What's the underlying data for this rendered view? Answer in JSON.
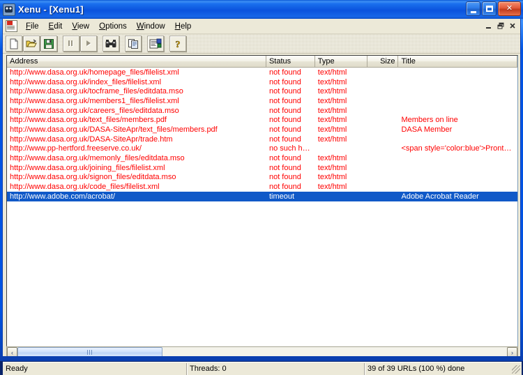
{
  "window": {
    "title": "Xenu - [Xenu1]",
    "app_icon": "xenu-cat-icon",
    "controls": {
      "minimize": "Minimize",
      "maximize": "Maximize",
      "close": "Close"
    }
  },
  "menubar": {
    "doc_icon": "document-icon",
    "items": [
      {
        "label": "File",
        "accel": "F"
      },
      {
        "label": "Edit",
        "accel": "E"
      },
      {
        "label": "View",
        "accel": "V"
      },
      {
        "label": "Options",
        "accel": "O"
      },
      {
        "label": "Window",
        "accel": "W"
      },
      {
        "label": "Help",
        "accel": "H"
      }
    ],
    "mdi_controls": {
      "minimize": "Minimize Document",
      "restore": "Restore Document",
      "close": "Close Document"
    }
  },
  "toolbar": {
    "buttons": [
      {
        "name": "new-file-button",
        "label": "New",
        "enabled": true
      },
      {
        "name": "open-file-button",
        "label": "Open",
        "enabled": true
      },
      {
        "name": "save-file-button",
        "label": "Save",
        "enabled": true
      },
      {
        "name": "pause-button",
        "label": "Pause",
        "enabled": false
      },
      {
        "name": "resume-button",
        "label": "Resume",
        "enabled": false
      },
      {
        "name": "find-button",
        "label": "Find",
        "enabled": true
      },
      {
        "name": "copy-button",
        "label": "Copy",
        "enabled": true
      },
      {
        "name": "properties-button",
        "label": "Properties",
        "enabled": true
      },
      {
        "name": "help-button",
        "label": "Help",
        "enabled": true
      }
    ]
  },
  "list": {
    "columns": [
      {
        "key": "address",
        "label": "Address",
        "align": "left"
      },
      {
        "key": "status",
        "label": "Status",
        "align": "left"
      },
      {
        "key": "type",
        "label": "Type",
        "align": "left"
      },
      {
        "key": "size",
        "label": "Size",
        "align": "right"
      },
      {
        "key": "title",
        "label": "Title",
        "align": "left"
      }
    ],
    "rows": [
      {
        "address": "http://www.dasa.org.uk/homepage_files/filelist.xml",
        "status": "not found",
        "type": "text/html",
        "size": "",
        "title": "",
        "state": "error"
      },
      {
        "address": "http://www.dasa.org.uk/index_files/filelist.xml",
        "status": "not found",
        "type": "text/html",
        "size": "",
        "title": "",
        "state": "error"
      },
      {
        "address": "http://www.dasa.org.uk/tocframe_files/editdata.mso",
        "status": "not found",
        "type": "text/html",
        "size": "",
        "title": "",
        "state": "error"
      },
      {
        "address": "http://www.dasa.org.uk/members1_files/filelist.xml",
        "status": "not found",
        "type": "text/html",
        "size": "",
        "title": "",
        "state": "error"
      },
      {
        "address": "http://www.dasa.org.uk/careers_files/editdata.mso",
        "status": "not found",
        "type": "text/html",
        "size": "",
        "title": "",
        "state": "error"
      },
      {
        "address": "http://www.dasa.org.uk/text_files/members.pdf",
        "status": "not found",
        "type": "text/html",
        "size": "",
        "title": "Members on line",
        "state": "error"
      },
      {
        "address": "http://www.dasa.org.uk/DASA-SiteApr/text_files/members.pdf",
        "status": "not found",
        "type": "text/html",
        "size": "",
        "title": "DASA Member",
        "state": "error"
      },
      {
        "address": "http://www.dasa.org.uk/DASA-SiteApr/trade.htm",
        "status": "not found",
        "type": "text/html",
        "size": "",
        "title": "",
        "state": "error"
      },
      {
        "address": "http://www.pp-hertford.freeserve.co.uk/",
        "status": "no such host",
        "type": "",
        "size": "",
        "title": "<span style='color:blue'>Prontap…",
        "state": "error"
      },
      {
        "address": "http://www.dasa.org.uk/memonly_files/editdata.mso",
        "status": "not found",
        "type": "text/html",
        "size": "",
        "title": "",
        "state": "error"
      },
      {
        "address": "http://www.dasa.org.uk/joining_files/filelist.xml",
        "status": "not found",
        "type": "text/html",
        "size": "",
        "title": "",
        "state": "error"
      },
      {
        "address": "http://www.dasa.org.uk/signon_files/editdata.mso",
        "status": "not found",
        "type": "text/html",
        "size": "",
        "title": "",
        "state": "error"
      },
      {
        "address": "http://www.dasa.org.uk/code_files/filelist.xml",
        "status": "not found",
        "type": "text/html",
        "size": "",
        "title": "",
        "state": "error"
      },
      {
        "address": "http://www.adobe.com/acrobat/",
        "status": "timeout",
        "type": "",
        "size": "",
        "title": "Adobe Acrobat Reader",
        "state": "selected"
      }
    ]
  },
  "hscrollbar": {
    "left_arrow": "‹",
    "right_arrow": "›",
    "thumb_grip": "scrollbar-grip"
  },
  "statusbar": {
    "message": "Ready",
    "threads": "Threads: 0",
    "progress": "39 of 39 URLs (100 %) done"
  },
  "colors": {
    "error_text": "#ff0000",
    "selection_bg": "#1059c8",
    "title_bar_blue": "#0054e3",
    "face": "#ece9d8"
  }
}
